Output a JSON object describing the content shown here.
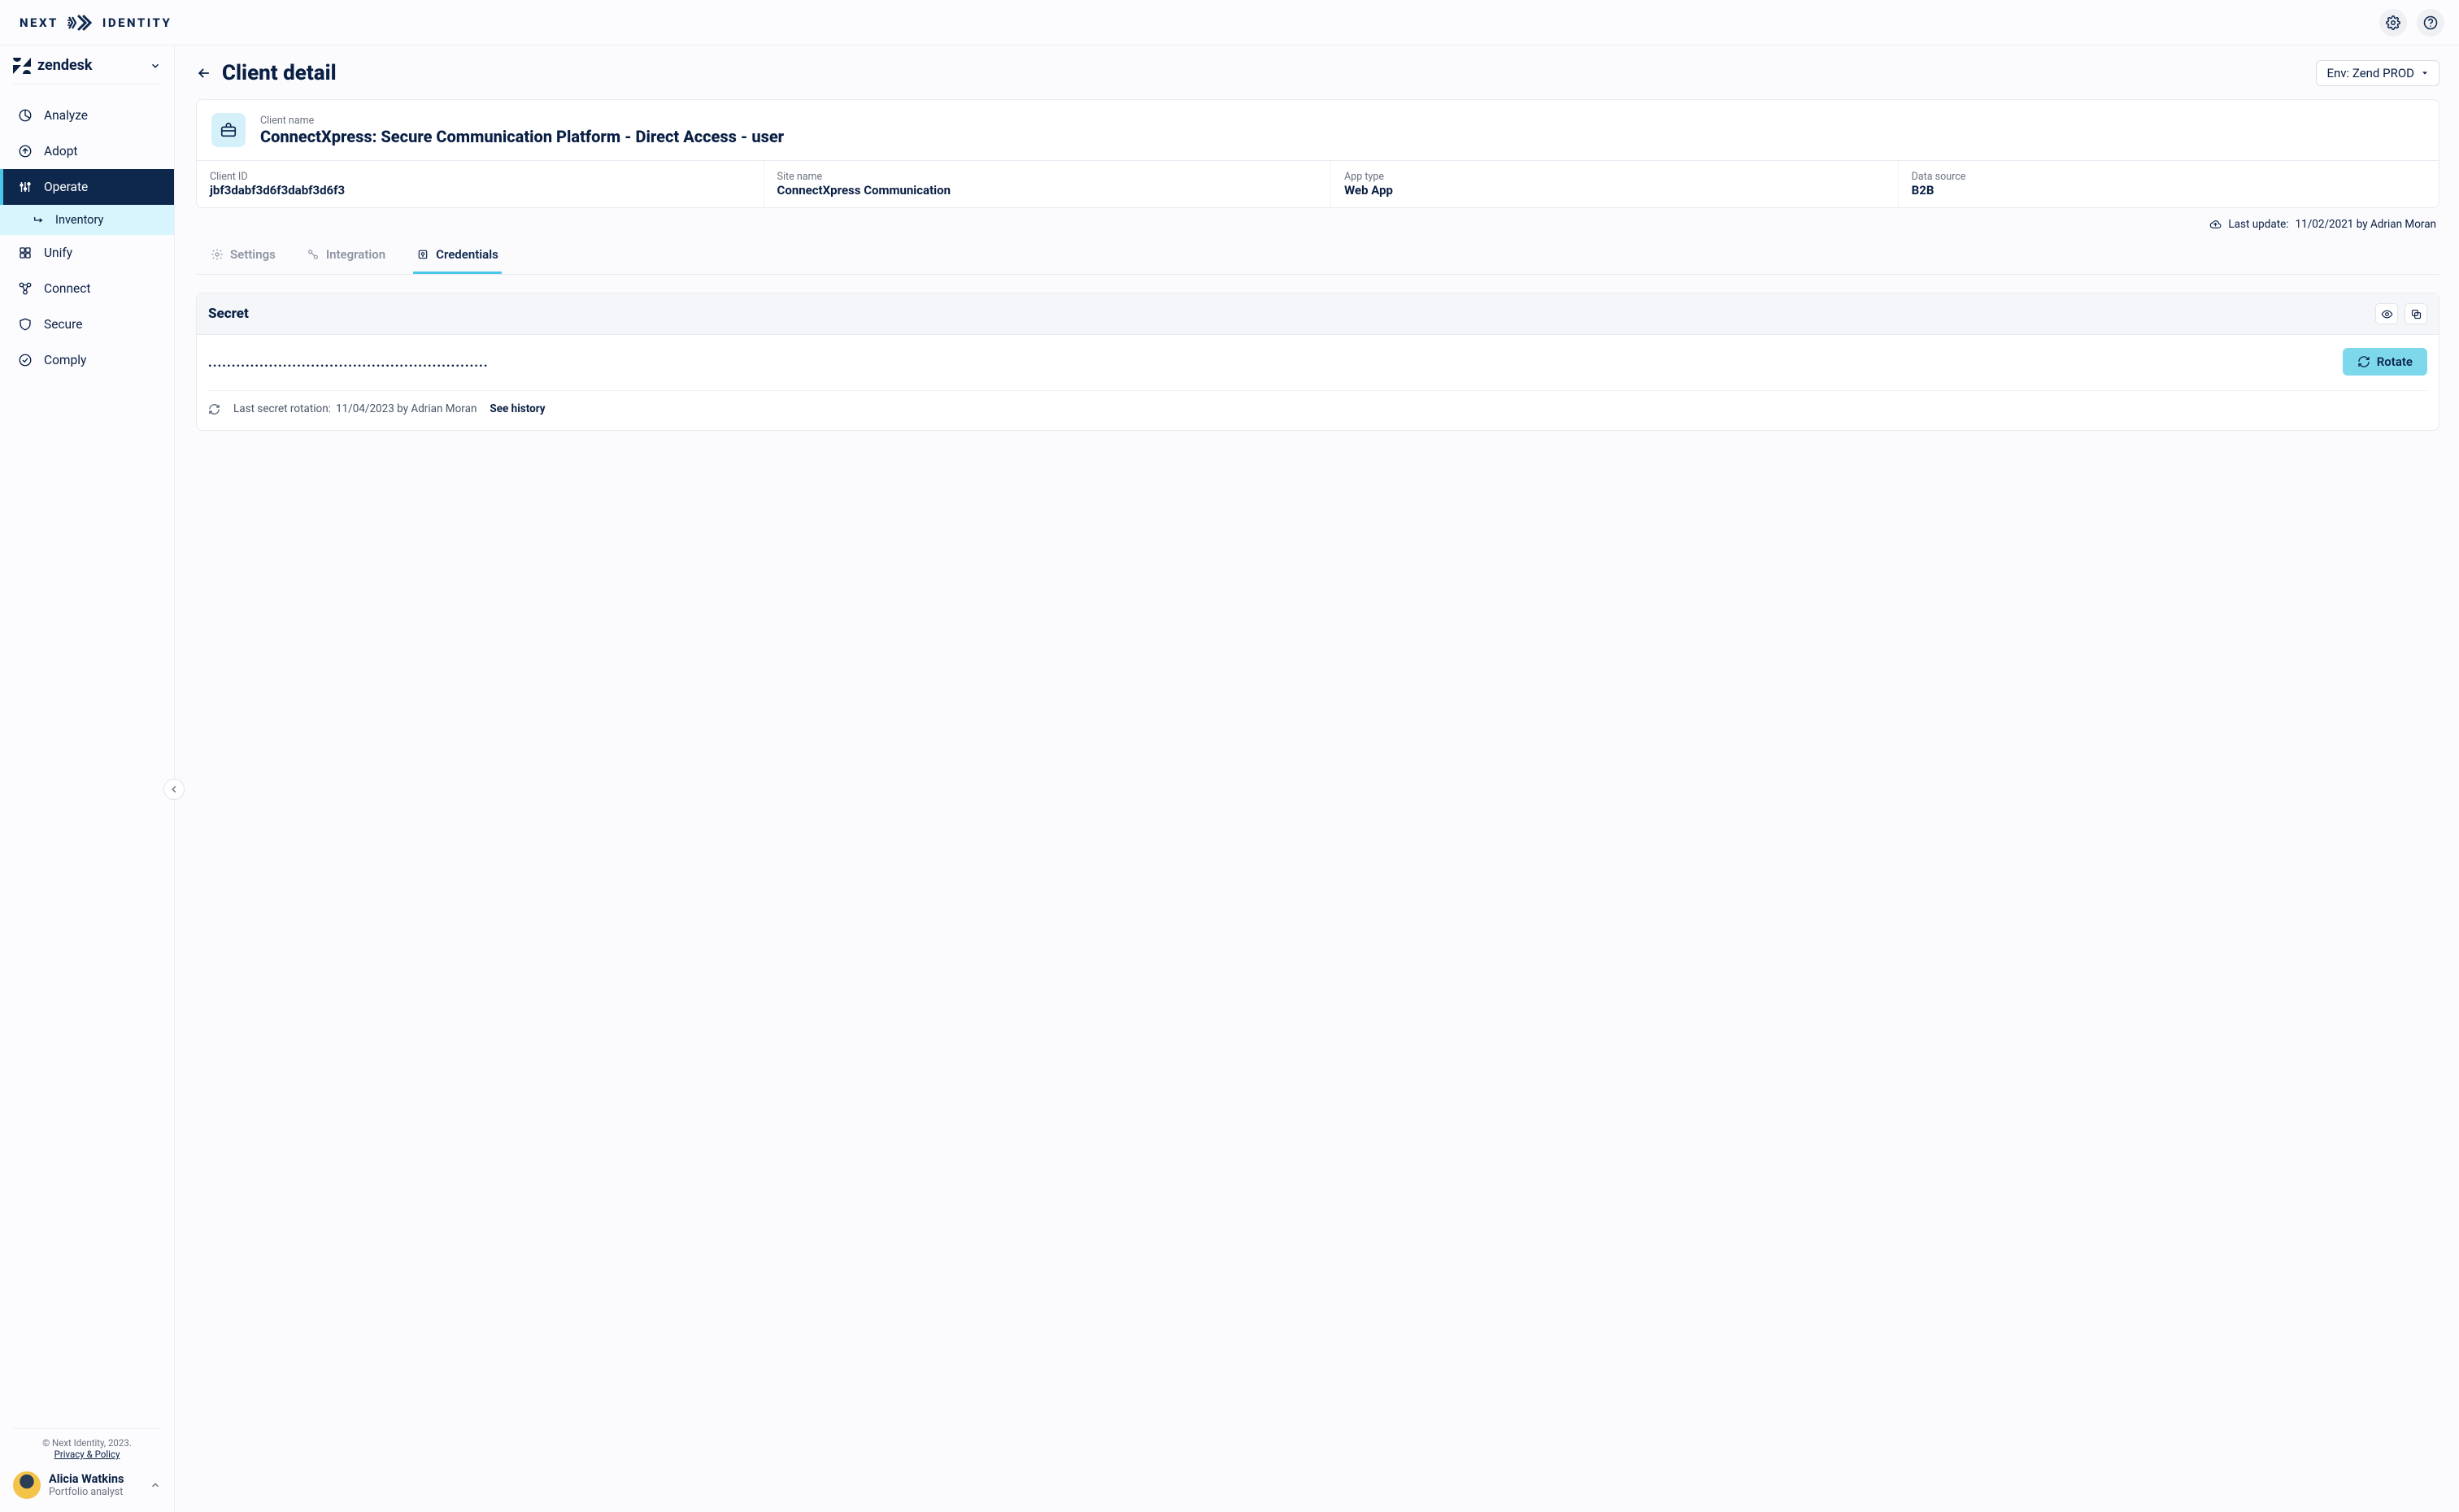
{
  "brand": {
    "left": "NEXT",
    "right": "IDENTITY"
  },
  "org": {
    "name": "zendesk"
  },
  "sidebar": {
    "items": [
      {
        "icon": "pie-icon",
        "label": "Analyze"
      },
      {
        "icon": "adopt-icon",
        "label": "Adopt"
      },
      {
        "icon": "operate-icon",
        "label": "Operate",
        "active": true,
        "sub": {
          "label": "Inventory"
        }
      },
      {
        "icon": "unify-icon",
        "label": "Unify"
      },
      {
        "icon": "connect-icon",
        "label": "Connect"
      },
      {
        "icon": "shield-icon",
        "label": "Secure"
      },
      {
        "icon": "check-icon",
        "label": "Comply"
      }
    ],
    "footer": {
      "copyright": "© Next Identity, 2023.",
      "policy": "Privacy & Policy"
    }
  },
  "user": {
    "name": "Alicia Watkins",
    "role": "Portfolio analyst"
  },
  "page": {
    "title": "Client detail",
    "env_label": "Env: Zend PROD"
  },
  "client": {
    "name_label": "Client name",
    "name": "ConnectXpress: Secure Communication Platform - Direct Access - user",
    "fields": [
      {
        "label": "Client ID",
        "value": "jbf3dabf3d6f3dabf3d6f3"
      },
      {
        "label": "Site name",
        "value": "ConnectXpress Communication"
      },
      {
        "label": "App type",
        "value": "Web App"
      },
      {
        "label": "Data source",
        "value": "B2B"
      }
    ],
    "last_update_label": "Last update:",
    "last_update_value": "11/02/2021 by Adrian Moran"
  },
  "tabs": [
    {
      "icon": "gear-icon",
      "label": "Settings"
    },
    {
      "icon": "plug-icon",
      "label": "Integration"
    },
    {
      "icon": "key-icon",
      "label": "Credentials",
      "active": true
    }
  ],
  "secret": {
    "heading": "Secret",
    "mask": "............................................................",
    "rotate_label": "Rotate",
    "rotation_label": "Last secret rotation:",
    "rotation_value": "11/04/2023 by Adrian Moran",
    "history_label": "See history"
  }
}
